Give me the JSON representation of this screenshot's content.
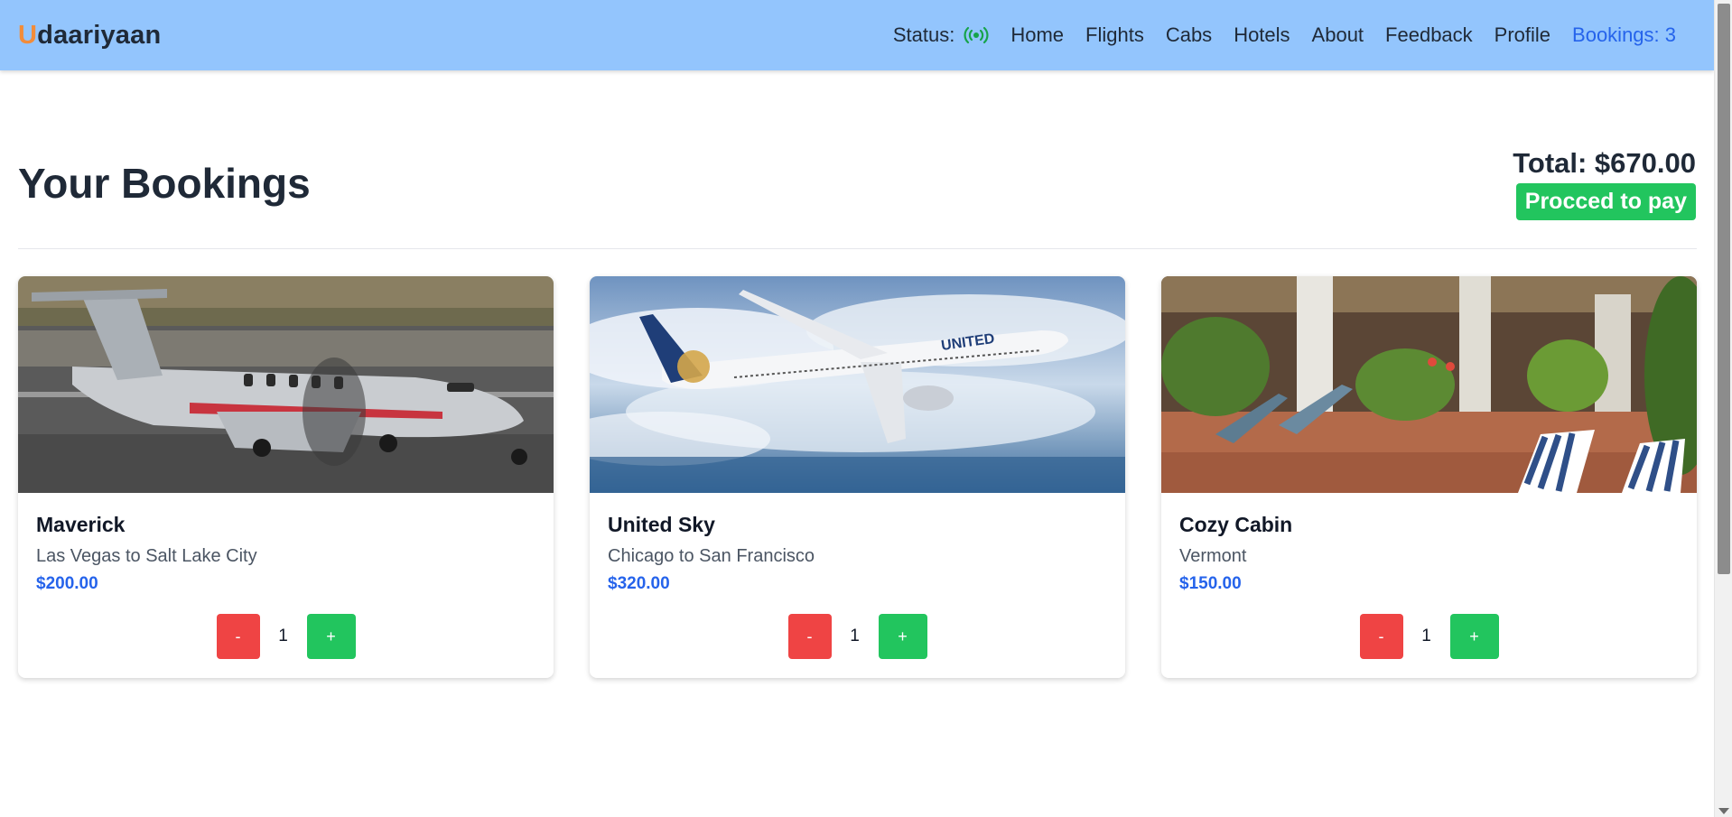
{
  "brand": {
    "first_letter": "U",
    "rest": "daariyaan"
  },
  "nav": {
    "status_label": "Status:",
    "status_icon": "broadcast-signal-icon",
    "links": [
      "Home",
      "Flights",
      "Cabs",
      "Hotels",
      "About",
      "Feedback",
      "Profile"
    ],
    "bookings_label": "Bookings: 3"
  },
  "page": {
    "title": "Your Bookings",
    "total": "Total: $670.00",
    "pay_button": "Procced to pay"
  },
  "bookings": [
    {
      "name": "Maverick",
      "route": "Las Vegas to Salt Lake City",
      "price": "$200.00",
      "qty": "1",
      "minus": "-",
      "plus": "+",
      "image": "small-propeller-plane-photo"
    },
    {
      "name": "United Sky",
      "route": "Chicago to San Francisco",
      "price": "$320.00",
      "qty": "1",
      "minus": "-",
      "plus": "+",
      "image": "united-jet-over-clouds-photo"
    },
    {
      "name": "Cozy Cabin",
      "route": "Vermont",
      "price": "$150.00",
      "qty": "1",
      "minus": "-",
      "plus": "+",
      "image": "resort-patio-loungers-photo"
    }
  ],
  "colors": {
    "navbar": "#93c5fd",
    "accent": "#2563eb",
    "brand_first": "#f28c3a",
    "success": "#22c55e",
    "danger": "#ef4444",
    "status_icon": "#16a34a"
  }
}
